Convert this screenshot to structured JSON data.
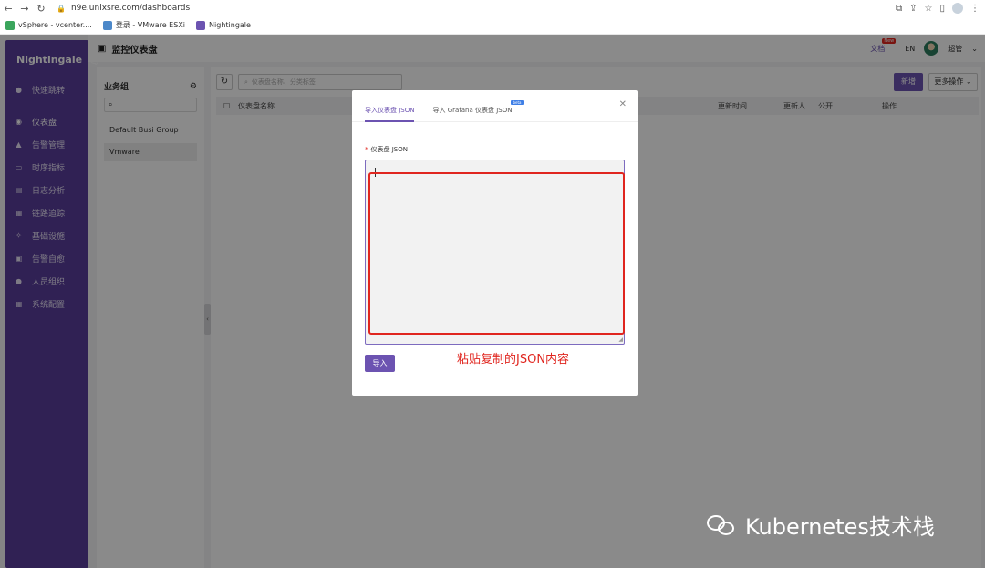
{
  "browser": {
    "url": "n9e.unixsre.com/dashboards",
    "bookmarks": [
      {
        "label": "vSphere - vcenter...."
      },
      {
        "label": "登录 - VMware ESXi"
      },
      {
        "label": "Nightingale"
      }
    ]
  },
  "app": {
    "logo_text": "Nightingale",
    "page_title": "监控仪表盘",
    "header": {
      "docs_label": "文档",
      "new_badge": "New",
      "lang": "EN",
      "user": "超管"
    },
    "sidebar": {
      "items": [
        {
          "label": "快速跳转",
          "icon": "dot-icon",
          "active": false
        },
        {
          "label": "仪表盘",
          "icon": "dashboard-icon",
          "active": true
        },
        {
          "label": "告警管理",
          "icon": "alert-icon",
          "active": false
        },
        {
          "label": "时序指标",
          "icon": "metric-icon",
          "active": false
        },
        {
          "label": "日志分析",
          "icon": "log-icon",
          "active": false
        },
        {
          "label": "链路追踪",
          "icon": "trace-icon",
          "active": false
        },
        {
          "label": "基础设施",
          "icon": "infra-icon",
          "active": false
        },
        {
          "label": "告警自愈",
          "icon": "heal-icon",
          "active": false
        },
        {
          "label": "人员组织",
          "icon": "user-icon",
          "active": false
        },
        {
          "label": "系统配置",
          "icon": "settings-icon",
          "active": false
        }
      ]
    },
    "groups": {
      "title": "业务组",
      "items": [
        {
          "label": "Default Busi Group"
        },
        {
          "label": "Vmware"
        }
      ]
    },
    "main": {
      "search_placeholder": "仪表盘名称、分类标签",
      "new_button": "新增",
      "more_button": "更多操作",
      "columns": [
        "仪表盘名称",
        "更新时间",
        "更新人",
        "公开",
        "操作"
      ]
    }
  },
  "modal": {
    "tabs": [
      {
        "label": "导入仪表盘 JSON",
        "active": true
      },
      {
        "label": "导入 Grafana 仪表盘 JSON",
        "badge": "beta",
        "active": false
      }
    ],
    "field_label": "仪表盘 JSON",
    "import_button": "导入"
  },
  "annotation": "粘贴复制的JSON内容",
  "watermark": "Kubernetes技术栈"
}
